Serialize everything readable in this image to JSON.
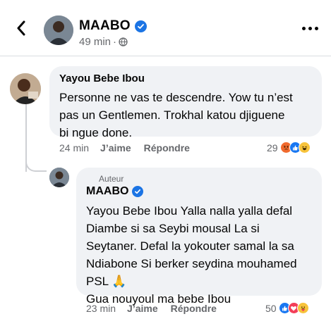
{
  "post": {
    "author": "MAABO",
    "time": "49 min",
    "back_icon": "arrow-back-icon",
    "privacy_icon": "globe-icon",
    "more_icon": "more-dots-icon"
  },
  "comment": {
    "author": "Yayou Bebe Ibou",
    "lines": [
      "Personne ne vas te descendre. Yow tu n’est",
      "pas un Gentlemen. Trokhal katou djiguene",
      "bi ngue done."
    ],
    "time": "24 min",
    "like_label": "J’aime",
    "reply_label": "Répondre",
    "reaction_count": "29",
    "reactions": [
      "angry",
      "like",
      "haha"
    ]
  },
  "reply": {
    "badge": "Auteur",
    "author": "MAABO",
    "lines": [
      "Yayou Bebe Ibou Yalla nalla yalla defal",
      "Diambe si sa Seybi mousal La si",
      "Seytaner. Defal la yokouter samal la sa",
      "Ndiabone Si berker seydina mouhamed",
      "PSL 🙏",
      "Gua nouyoul ma bebe Ibou"
    ],
    "time": "23 min",
    "like_label": "J’aime",
    "reply_label": "Répondre",
    "reaction_count": "50",
    "reactions": [
      "like",
      "love",
      "care"
    ]
  },
  "colors": {
    "verified": "#1b74e4",
    "bubble": "#f0f2f5",
    "secondary_text": "#65676b",
    "angry": "#f06a2e",
    "like": "#1877f2",
    "haha": "#f7c33b",
    "love": "#f33e58"
  }
}
